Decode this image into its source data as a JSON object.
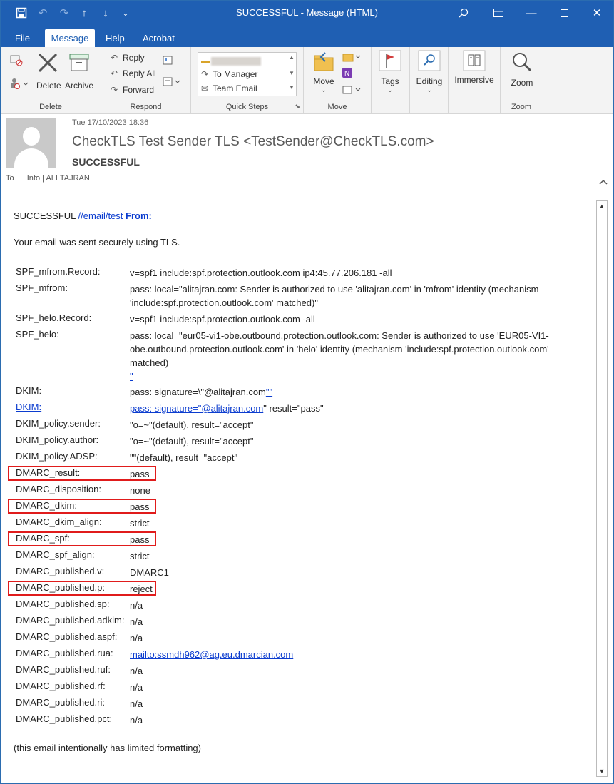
{
  "titlebar": {
    "title": "SUCCESSFUL  -  Message (HTML)"
  },
  "tabs": [
    "File",
    "Message",
    "Help",
    "Acrobat"
  ],
  "ribbon": {
    "delete_group": {
      "label": "Delete",
      "delete": "Delete",
      "archive": "Archive"
    },
    "respond_group": {
      "label": "Respond",
      "reply": "Reply",
      "reply_all": "Reply All",
      "forward": "Forward"
    },
    "quick_steps_group": {
      "label": "Quick Steps",
      "items": [
        "To Manager",
        "Team Email"
      ]
    },
    "move_group": {
      "label": "Move",
      "move": "Move"
    },
    "tags": "Tags",
    "editing": "Editing",
    "immersive": "Immersive",
    "zoom_group": {
      "label": "Zoom",
      "zoom": "Zoom"
    }
  },
  "header": {
    "date": "Tue 17/10/2023 18:36",
    "from": "CheckTLS Test Sender TLS <TestSender@CheckTLS.com>",
    "subject": "SUCCESSFUL",
    "to_label": "To",
    "to": "Info | ALI TAJRAN"
  },
  "message": {
    "intro_prefix": "SUCCESSFUL ",
    "intro_link": "//email/test",
    "intro_link_bold": "From:",
    "sent_line": "Your email was sent securely using TLS.",
    "closing": "(this email intentionally has limited formatting)",
    "fields": [
      {
        "key": "SPF_mfrom.Record:",
        "value": "v=spf1 include:spf.protection.outlook.com ip4:45.77.206.181 -all"
      },
      {
        "key": "SPF_mfrom:",
        "value": "pass: local=\"alitajran.com: Sender is authorized to use 'alitajran.com' in 'mfrom' identity (mechanism 'include:spf.protection.outlook.com' matched)\""
      },
      {
        "key": "SPF_helo.Record:",
        "value": "v=spf1 include:spf.protection.outlook.com -all"
      },
      {
        "key": "SPF_helo:",
        "value": "pass: local=\"eur05-vi1-obe.outbound.protection.outlook.com: Sender is authorized to use 'EUR05-VI1-obe.outbound.protection.outlook.com' in 'helo' identity (mechanism 'include:spf.protection.outlook.com' matched)",
        "value_link": "\""
      },
      {
        "key": "DKIM:",
        "value": "pass: signature=\\\"@alitajran.com",
        "value_link": "\"\""
      },
      {
        "key_link": "DKIM:",
        "value_link": "pass: signature=\"@alitajran.com",
        "value": "\" result=\"pass\""
      },
      {
        "key": "DKIM_policy.sender:",
        "value": "\"o=~\"(default), result=\"accept\""
      },
      {
        "key": "DKIM_policy.author:",
        "value": "\"o=~\"(default), result=\"accept\""
      },
      {
        "key": "DKIM_policy.ADSP:",
        "value": "\"\"(default), result=\"accept\""
      },
      {
        "key": "DMARC_result:",
        "value": "pass",
        "highlight": true
      },
      {
        "key": "DMARC_disposition:",
        "value": "none"
      },
      {
        "key": "DMARC_dkim:",
        "value": "pass",
        "highlight": true
      },
      {
        "key": "DMARC_dkim_align:",
        "value": "strict"
      },
      {
        "key": "DMARC_spf:",
        "value": "pass",
        "highlight": true
      },
      {
        "key": "DMARC_spf_align:",
        "value": "strict"
      },
      {
        "key": "DMARC_published.v:",
        "value": "DMARC1"
      },
      {
        "key": "DMARC_published.p:",
        "value": "reject",
        "highlight": true
      },
      {
        "key": "DMARC_published.sp:",
        "value": "n/a"
      },
      {
        "key": "DMARC_published.adkim:",
        "value": "n/a"
      },
      {
        "key": "DMARC_published.aspf:",
        "value": "n/a"
      },
      {
        "key": "DMARC_published.rua:",
        "value_link": "mailto:ssmdh962@ag.eu.dmarcian.com"
      },
      {
        "key": "DMARC_published.ruf:",
        "value": "n/a"
      },
      {
        "key": "DMARC_published.rf:",
        "value": "n/a"
      },
      {
        "key": "DMARC_published.ri:",
        "value": "n/a"
      },
      {
        "key": "DMARC_published.pct:",
        "value": "n/a"
      }
    ]
  },
  "colors": {
    "titlebar": "#1f5fb3",
    "highlight_border": "#e01b1b",
    "link": "#0b3ccf"
  }
}
